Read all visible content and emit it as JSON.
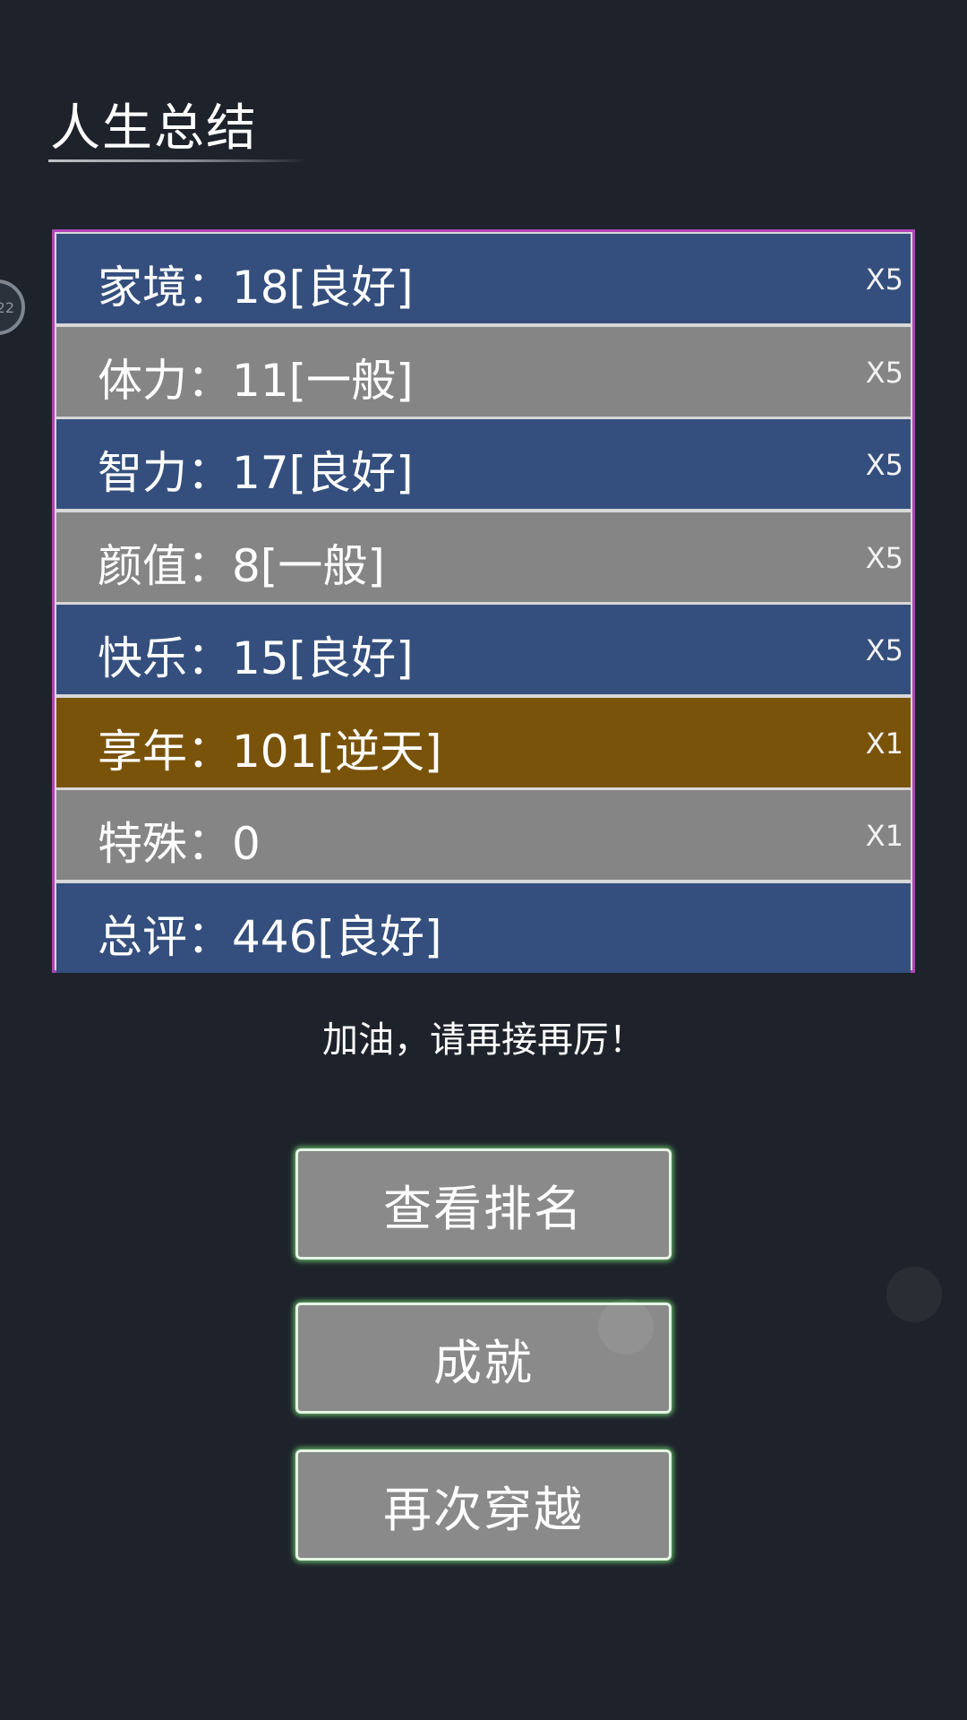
{
  "header": {
    "title": "人生总结"
  },
  "side_badge": {
    "text": "22"
  },
  "stats": [
    {
      "text": "家境：18[良好]",
      "multiplier": "X5",
      "color": "blue"
    },
    {
      "text": "体力：11[一般]",
      "multiplier": "X5",
      "color": "gray"
    },
    {
      "text": "智力：17[良好]",
      "multiplier": "X5",
      "color": "blue"
    },
    {
      "text": "颜值：8[一般]",
      "multiplier": "X5",
      "color": "gray"
    },
    {
      "text": "快乐：15[良好]",
      "multiplier": "X5",
      "color": "blue"
    },
    {
      "text": "享年：101[逆天]",
      "multiplier": "X1",
      "color": "gold"
    },
    {
      "text": "特殊：0",
      "multiplier": "X1",
      "color": "gray"
    },
    {
      "text": "总评：446[良好]",
      "multiplier": "",
      "color": "blue"
    }
  ],
  "message": "加油，请再接再厉！",
  "buttons": {
    "ranking": "查看排名",
    "achievements": "成就",
    "replay": "再次穿越"
  },
  "colors": {
    "background": "#1e232b",
    "row_blue": "#344f7d",
    "row_gray": "#858585",
    "row_gold": "#7a530a",
    "panel_border": "#b044b8",
    "button_glow": "#78e678"
  }
}
